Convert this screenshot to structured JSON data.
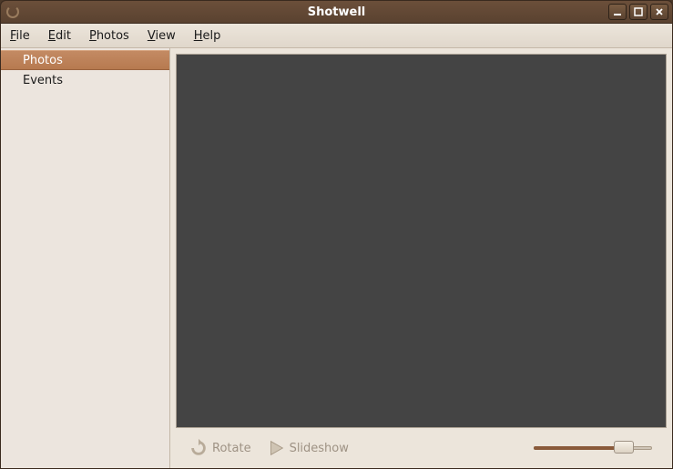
{
  "window": {
    "title": "Shotwell"
  },
  "menubar": {
    "items": [
      {
        "label": "File",
        "mnemonic": "F"
      },
      {
        "label": "Edit",
        "mnemonic": "E"
      },
      {
        "label": "Photos",
        "mnemonic": "P"
      },
      {
        "label": "View",
        "mnemonic": "V"
      },
      {
        "label": "Help",
        "mnemonic": "H"
      }
    ]
  },
  "sidebar": {
    "items": [
      {
        "label": "Photos",
        "selected": true
      },
      {
        "label": "Events",
        "selected": false
      }
    ]
  },
  "toolbar": {
    "rotate_label": "Rotate",
    "slideshow_label": "Slideshow",
    "zoom_value_percent": 70
  },
  "colors": {
    "canvas_bg": "#444444",
    "accent": "#b77a50",
    "chrome_bg": "#ece5db"
  }
}
